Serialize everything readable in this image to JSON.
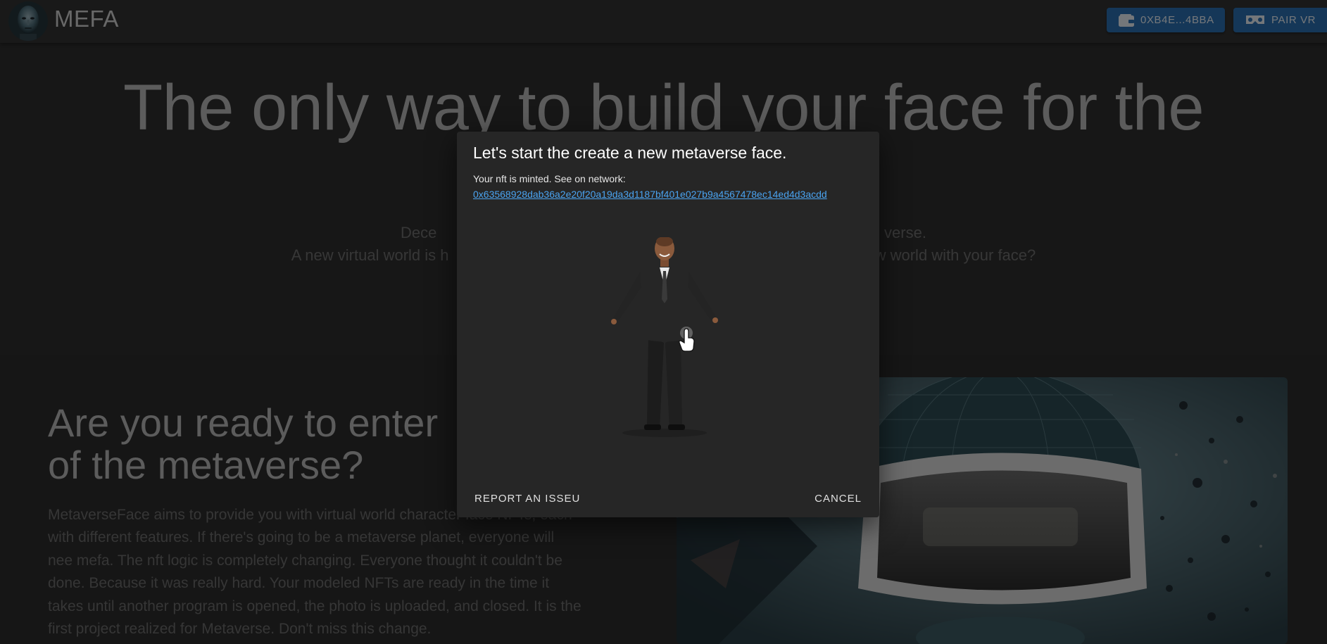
{
  "brand": {
    "name": "MEFA",
    "logo_icon": "face-avatar-icon"
  },
  "header": {
    "wallet_label": "0XB4E...4BBA",
    "pair_vr_label": "PAIR VR",
    "accent": "#2a6fb0"
  },
  "hero": {
    "title": "The only way to build your face for the",
    "sub_line1": "Dece                                                                                                        verse.",
    "sub_line2": "A new virtual world is h                                                                                                   w world with your face?"
  },
  "section": {
    "title_line1": "Are you ready to enter",
    "title_line2": "of the metaverse?",
    "body_lines": [
      "MetaverseFace aims to provide you with virtual world character face NFTs, each",
      "with different features. If there's going to be a metaverse planet, everyone will",
      "nee mefa. The nft logic is completely changing. Everyone thought it couldn't be",
      "done. Because it was really hard. Your modeled NFTs are ready in the time it",
      "takes until another program is opened, the photo is uploaded, and closed. It is the",
      "first project realized for Metaverse. Don't miss this change."
    ]
  },
  "modal": {
    "title": "Let's start the create a new metaverse face.",
    "message": "Your nft is minted. See on network:",
    "tx_hash": "0x63568928dab36a2e20f20a19da3d1187bf401e027b9a4567478ec14ed4d3acdd",
    "report_label": "REPORT AN ISSEU",
    "cancel_label": "CANCEL"
  }
}
